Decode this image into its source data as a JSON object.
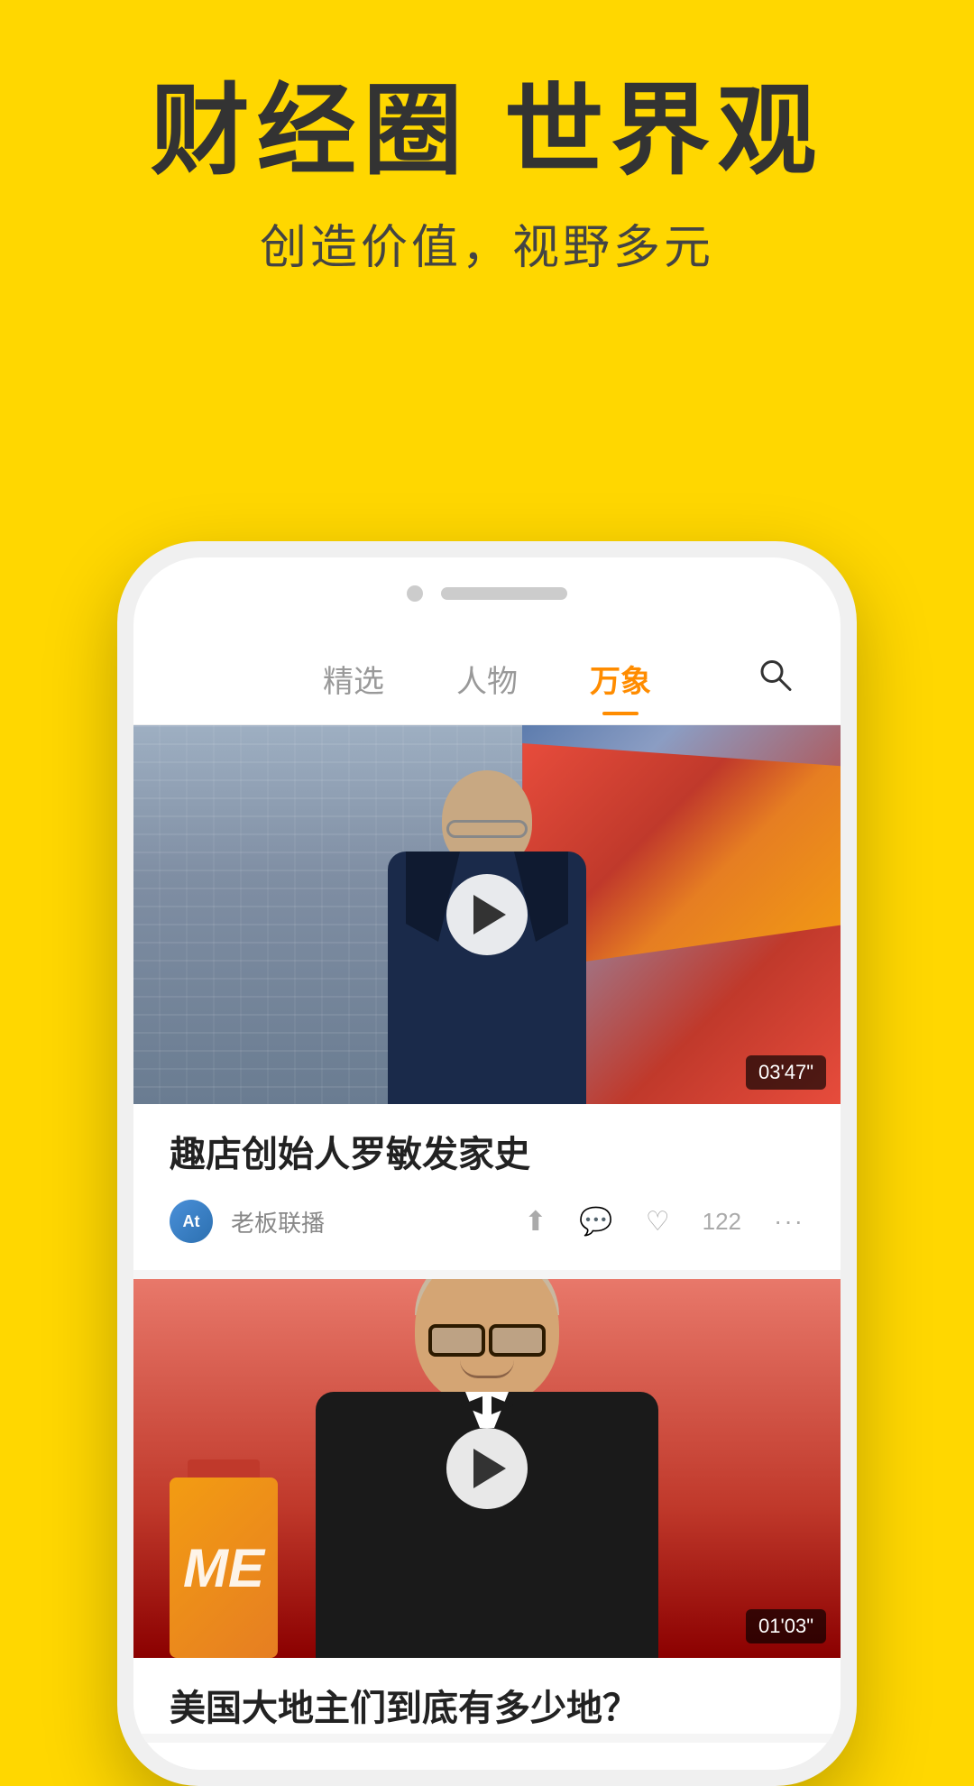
{
  "header": {
    "main_title": "财经圈 世界观",
    "sub_title": "创造价值，视野多元"
  },
  "nav": {
    "tabs": [
      {
        "label": "精选",
        "active": false
      },
      {
        "label": "人物",
        "active": false
      },
      {
        "label": "万象",
        "active": true
      }
    ],
    "search_label": "搜索"
  },
  "articles": [
    {
      "title": "趣店创始人罗敏发家史",
      "duration": "03'47\"",
      "author": "老板联播",
      "author_initial": "At",
      "likes": "122",
      "has_video": true
    },
    {
      "title": "美国大地主们到底有多少地？",
      "duration": "01'03\"",
      "has_video": true
    }
  ]
}
